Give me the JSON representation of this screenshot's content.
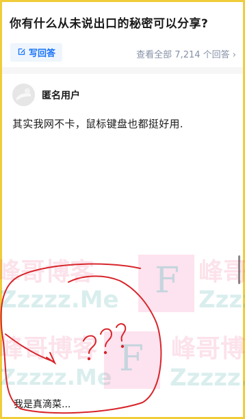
{
  "question": {
    "title": "你有什么从未说出口的秘密可以分享?"
  },
  "actions": {
    "write_label": "写回答",
    "view_all": "查看全部 7,214 个回答",
    "chevron": "›"
  },
  "answer": {
    "author_name": "匿名用户",
    "content": "其实我网不卡，鼠标键盘也都挺好用.",
    "truncated_text": "我是真滴菜..."
  },
  "watermark": {
    "cn": "峰哥博客",
    "en": "Zzzzz.Me",
    "letter": "F"
  },
  "icons": {
    "write": "edit-icon",
    "avatar": "anonymous-avatar-icon"
  },
  "colors": {
    "accent": "#1772f6",
    "frame": "#f0cc3a",
    "doodle": "#d8242a"
  }
}
